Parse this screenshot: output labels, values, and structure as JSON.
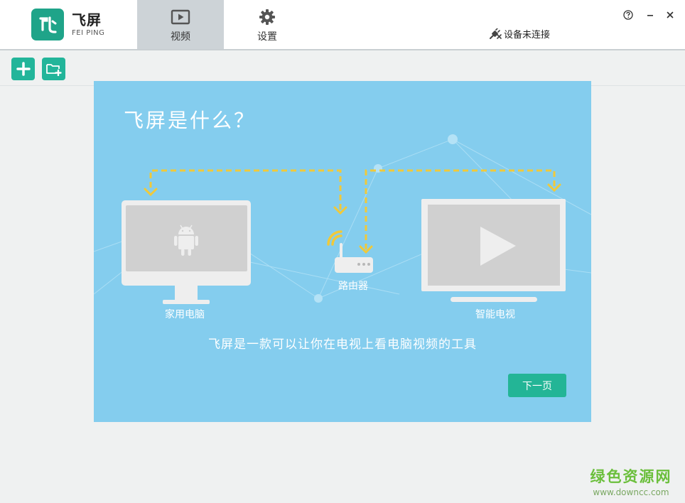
{
  "app": {
    "brand_cn": "飞屏",
    "brand_en": "FEI PING",
    "logo_icon": "fei-logo-icon"
  },
  "nav": {
    "tabs": [
      {
        "label": "视频",
        "icon": "video-icon",
        "active": true
      },
      {
        "label": "设置",
        "icon": "gear-icon",
        "active": false
      }
    ]
  },
  "status": {
    "text": "设备未连接",
    "icon": "disconnected-plug-icon"
  },
  "window_controls": [
    "help-icon",
    "minimize-icon",
    "close-icon"
  ],
  "toolbar": {
    "buttons": [
      "add-icon",
      "add-folder-icon"
    ]
  },
  "intro": {
    "title": "飞屏是什么？",
    "pc_label": "家用电脑",
    "router_label": "路由器",
    "tv_label": "智能电视",
    "description": "飞屏是一款可以让你在电视上看电脑视频的工具",
    "next_label": "下一页"
  },
  "watermark": {
    "cn": "绿色资源网",
    "url": "www.downcc.com"
  },
  "colors": {
    "accent": "#22b59a",
    "panel_bg": "#84cdee",
    "arrow": "#f0c93a",
    "device": "#eeeeee",
    "screen": "#d0d0d0"
  }
}
